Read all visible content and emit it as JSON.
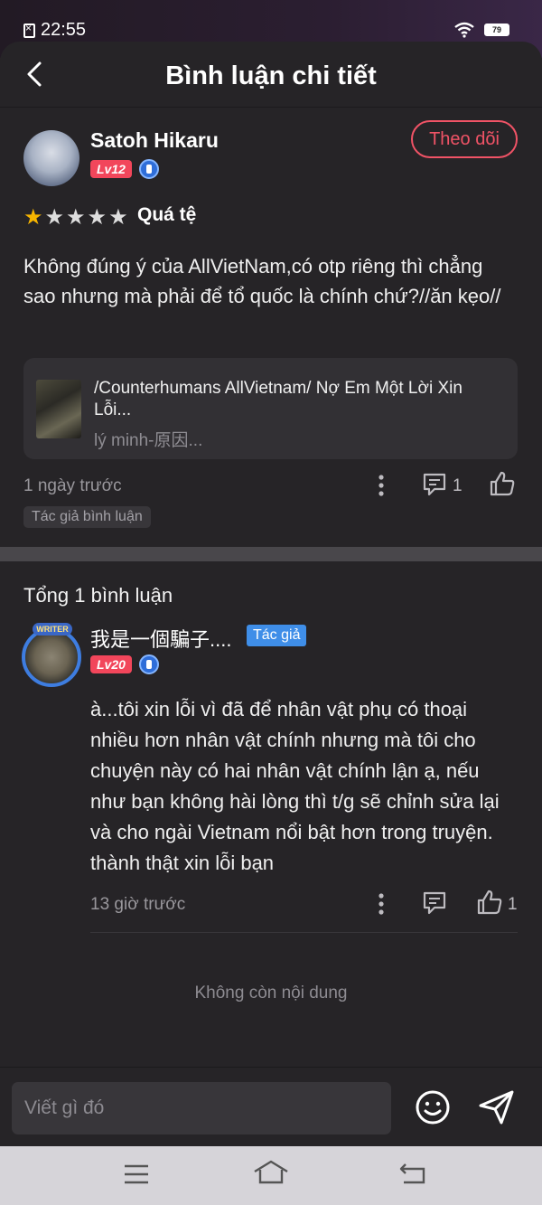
{
  "status_bar": {
    "time": "22:55",
    "battery": "79"
  },
  "header": {
    "title": "Bình luận chi tiết"
  },
  "comment": {
    "user": {
      "name": "Satoh Hikaru",
      "level": "Lv12"
    },
    "follow_label": "Theo dõi",
    "rating": {
      "stars_filled": 1,
      "stars_total": 5,
      "label": "Quá tệ"
    },
    "text": "Không đúng ý của AllVietNam,có otp riêng thì chẳng sao nhưng mà phải để tổ quốc là chính chứ?//ăn kẹo//",
    "book": {
      "title": "/Counterhumans AllVietnam/ Nợ Em Một Lời Xin Lỗi...",
      "author": "lý minh-原因..."
    },
    "time": "1 ngày trước",
    "reply_count": "1",
    "tag": "Tác giả bình luận"
  },
  "replies_section": {
    "total_label": "Tổng 1 bình luận",
    "reply": {
      "user": {
        "name": "我是一個騙子....",
        "level": "Lv20",
        "badge": "Tác giả",
        "writer_badge": "WRITER"
      },
      "text": "à...tôi xin lỗi vì đã để nhân vật phụ có thoại nhiều hơn nhân vật chính nhưng mà tôi cho chuyện này có hai nhân vật chính lận ạ, nếu như bạn không hài lòng thì t/g sẽ chỉnh sửa lại và cho ngài Vietnam nổi bật hơn trong truyện. thành thật xin lỗi bạn",
      "time": "13 giờ trước",
      "like_count": "1"
    },
    "end_label": "Không còn nội dung"
  },
  "composer": {
    "placeholder": "Viết gì đó"
  },
  "colors": {
    "accent": "#f05366",
    "level_badge": "#f2465b",
    "author_badge": "#3f8ee8",
    "star": "#f7b500"
  },
  "icons": [
    "back-icon",
    "shield-icon",
    "more-icon",
    "reply-icon",
    "like-icon",
    "emoji-icon",
    "send-icon",
    "menu-icon",
    "home-icon",
    "back-nav-icon"
  ]
}
